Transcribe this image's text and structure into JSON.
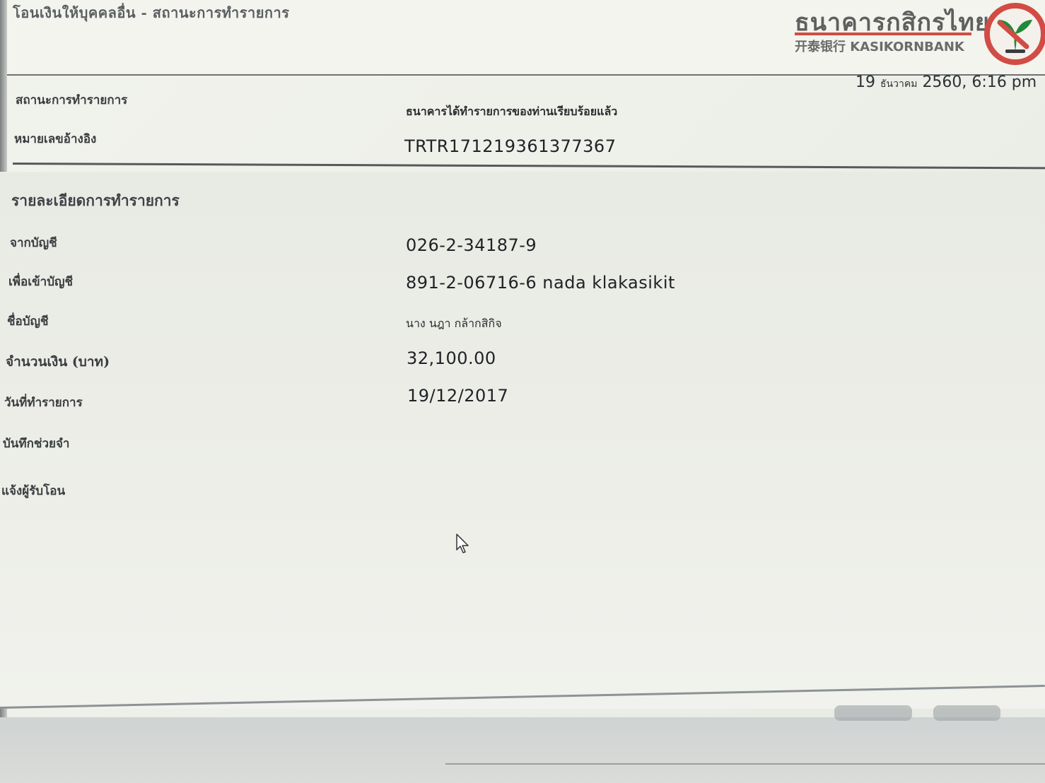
{
  "header": {
    "title": "โอนเงินให้บุคคลอื่น - สถานะการทำรายการ",
    "bank_name_th": "ธนาคารกสิกรไทย",
    "bank_name_en": "开泰银行 KASIKORNBANK",
    "logo_icon": "kasikorn-leaf-logo-icon",
    "brand_color": "#d24b45",
    "logo_green": "#1f8a3a"
  },
  "timestamp": {
    "day": "19",
    "month": "ธันวาคม",
    "rest": "2560, 6:16 pm"
  },
  "status_section": {
    "status_label": "สถานะการทำรายการ",
    "status_value": "ธนาคารได้ทำรายการของท่านเรียบร้อยแล้ว",
    "ref_label": "หมายเลขอ้างอิง",
    "ref_value": "TRTR171219361377367"
  },
  "details": {
    "heading": "รายละเอียดการทำรายการ",
    "from_account_label": "จากบัญชี",
    "from_account_value": "026-2-34187-9",
    "to_account_label": "เพื่อเข้าบัญชี",
    "to_account_value": "891-2-06716-6 nada klakasikit",
    "account_name_label": "ชื่อบัญชี",
    "account_name_value": "นาง นฎา กล้ากสิกิจ",
    "amount_label": "จำนวนเงิน (บาท)",
    "amount_value": "32,100.00",
    "date_label": "วันที่ทำรายการ",
    "date_value": "19/12/2017",
    "memo_label": "บันทึกช่วยจำ",
    "notify_label": "แจ้งผู้รับโอน"
  }
}
